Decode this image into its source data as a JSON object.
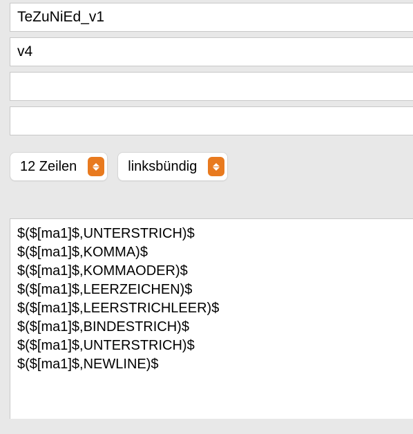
{
  "fields": {
    "field1": {
      "value": "TeZuNiEd_v1"
    },
    "field2": {
      "value": "v4"
    },
    "field3": {
      "value": ""
    },
    "field4": {
      "value": ""
    }
  },
  "dropdowns": {
    "lines": {
      "label": "12 Zeilen"
    },
    "alignment": {
      "label": "linksbündig"
    }
  },
  "textarea": {
    "lines": [
      "$($[ma1]$,UNTERSTRICH)$",
      "$($[ma1]$,KOMMA)$",
      "$($[ma1]$,KOMMAODER)$",
      "$($[ma1]$,LEERZEICHEN)$",
      "$($[ma1]$,LEERSTRICHLEER)$",
      "$($[ma1]$,BINDESTRICH)$",
      "$($[ma1]$,UNTERSTRICH)$",
      "$($[ma1]$,NEWLINE)$"
    ]
  }
}
